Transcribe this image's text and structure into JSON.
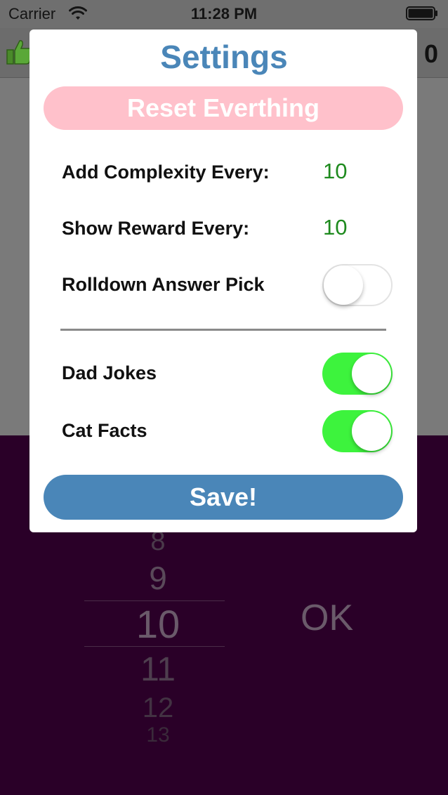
{
  "status_bar": {
    "carrier": "Carrier",
    "time": "11:28 PM"
  },
  "nav": {
    "score": "0",
    "icon": "thumbs-up-icon"
  },
  "settings": {
    "title": "Settings",
    "reset_label": "Reset Everthing",
    "rows": [
      {
        "label": "Add Complexity Every:",
        "value": "10"
      },
      {
        "label": "Show Reward Every:",
        "value": "10"
      }
    ],
    "rolldown": {
      "label": "Rolldown Answer Pick",
      "on": false
    },
    "dad_jokes": {
      "label": "Dad Jokes",
      "on": true
    },
    "cat_facts": {
      "label": "Cat Facts",
      "on": true
    },
    "save_label": "Save!"
  },
  "picker": {
    "items": [
      "8",
      "9",
      "10",
      "11",
      "12",
      "13"
    ],
    "selected": "10"
  },
  "ok_label": "OK",
  "colors": {
    "accent_blue": "#4a86b8",
    "reset_pink": "#ffc1cb",
    "value_green": "#1e8a1e",
    "toggle_on": "#3df33d",
    "background_purple": "#2a0028"
  }
}
